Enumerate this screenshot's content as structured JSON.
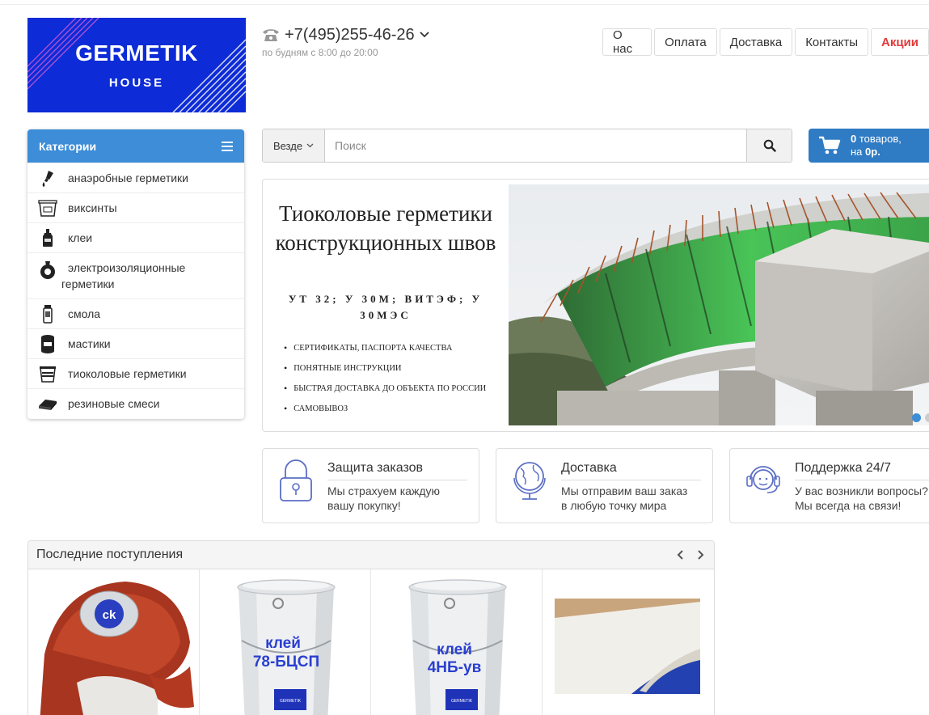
{
  "logo": {
    "main": "GERMETIK",
    "sub": "HOUSE"
  },
  "phone": {
    "number": "+7(495)255-46-26",
    "hours": "по будням с 8:00 до 20:00"
  },
  "topnav": [
    {
      "label": "О нас"
    },
    {
      "label": "Оплата"
    },
    {
      "label": "Доставка"
    },
    {
      "label": "Контакты"
    },
    {
      "label": "Акции"
    }
  ],
  "categories": {
    "title": "Категории",
    "items": [
      {
        "label": "анаэробные герметики",
        "icon": "sealant-drop-icon"
      },
      {
        "label": "виксинты",
        "icon": "bucket-icon"
      },
      {
        "label": "клеи",
        "icon": "glue-bottle-icon"
      },
      {
        "label": "электроизоляционные герметики",
        "icon": "insulating-sealant-icon"
      },
      {
        "label": "смола",
        "icon": "resin-tube-icon"
      },
      {
        "label": "мастики",
        "icon": "mastic-can-icon"
      },
      {
        "label": "тиоколовые герметики",
        "icon": "thiokol-bucket-icon"
      },
      {
        "label": "резиновые смеси",
        "icon": "rubber-compound-icon"
      }
    ]
  },
  "search": {
    "scope": "Везде",
    "placeholder": "Поиск"
  },
  "cart": {
    "count": "0",
    "count_suffix": " товаров,",
    "sum_prefix": "на ",
    "sum": "0р."
  },
  "banner": {
    "title": "Тиоколовые герметики конструкционных швов",
    "subtitle": "УТ 32; У 30М; ВИТЭФ; У 30МЭС",
    "bullets": [
      "сертификаты, паспорта качества",
      "понятные инструкции",
      "быстрая доставка до объекта по России",
      "самовывоз"
    ],
    "active_slide": 1,
    "colors": {
      "dot_active": "#3d8dd8",
      "dot_inactive": "#cccccc"
    }
  },
  "features": [
    {
      "title": "Защита заказов",
      "line1": "Мы страхуем каждую",
      "line2": "вашу покупку!",
      "icon": "padlock-icon"
    },
    {
      "title": "Доставка",
      "line1": "Мы отправим ваш заказ",
      "line2": "в любую точку мира",
      "icon": "globe-icon"
    },
    {
      "title": "Поддержка 24/7",
      "line1": "У вас возникли вопросы?",
      "line2": "Мы всегда на связи!",
      "icon": "headset-support-icon"
    }
  ],
  "latest": {
    "title": "Последние поступления",
    "products": [
      {
        "image": "red-tape-roll",
        "logo_text": "ck"
      },
      {
        "image": "bucket-glue",
        "label1": "клей",
        "label2": "78-БЦСП",
        "brand": "GERMETIK"
      },
      {
        "image": "bucket-glue",
        "label1": "клей",
        "label2": "4НБ-ув",
        "brand": "GERMETIK"
      },
      {
        "image": "paper-sheets"
      }
    ]
  },
  "colors": {
    "brand_blue": "#0d2bd6",
    "accent": "#3d8dd8",
    "cart": "#2f7bc4",
    "promo": "#e03a3a"
  }
}
